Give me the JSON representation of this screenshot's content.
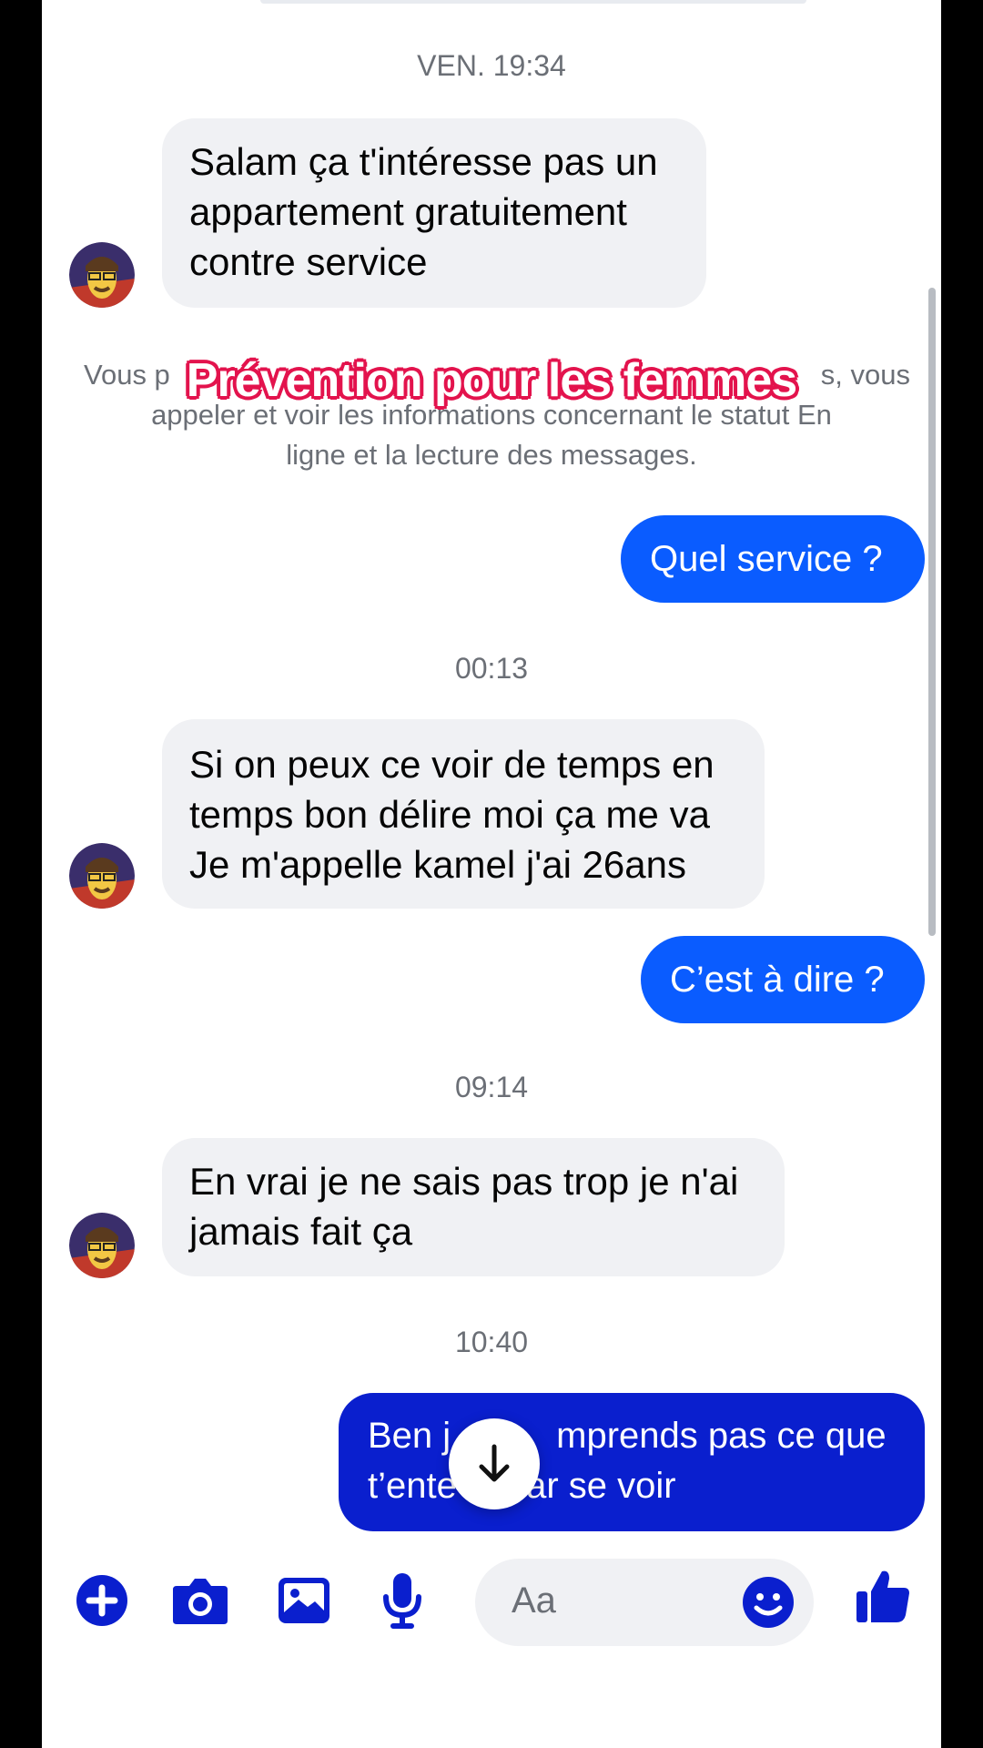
{
  "timestamps": [
    "VEN. 19:34",
    "00:13",
    "09:14",
    "10:40"
  ],
  "messages": {
    "m1": [
      "Salam ça t'intéresse pas un",
      "appartement gratuitement",
      "contre service"
    ],
    "m2": [
      "Quel service ?"
    ],
    "m3": [
      "Si on peux ce voir de temps en",
      "temps bon délire moi ça me va",
      "Je m'appelle kamel j'ai 26ans"
    ],
    "m4": [
      "C’est à dire ?"
    ],
    "m5": [
      "En vrai je ne sais pas trop je n'ai",
      "jamais fait ça"
    ],
    "m6": [
      "Ben j",
      "mprends pas ce que",
      "t’ente",
      "par se voir"
    ]
  },
  "notice": {
    "line1_left": "Vous p",
    "line1_right": "s, vous",
    "line2": "appeler et voir les informations concernant le statut En",
    "line3": "ligne et la lecture des messages."
  },
  "overlay_caption": "Prévention pour les femmes",
  "composer": {
    "placeholder": "Aa",
    "icons": [
      "plus-circle-icon",
      "camera-icon",
      "image-icon",
      "microphone-icon",
      "emoji-icon",
      "thumbs-up-icon"
    ]
  },
  "colors": {
    "accent": "#0a5cff",
    "accent_dark": "#0a1fce",
    "incoming_bubble": "#f0f1f4",
    "caption_outline": "#e3134d"
  }
}
